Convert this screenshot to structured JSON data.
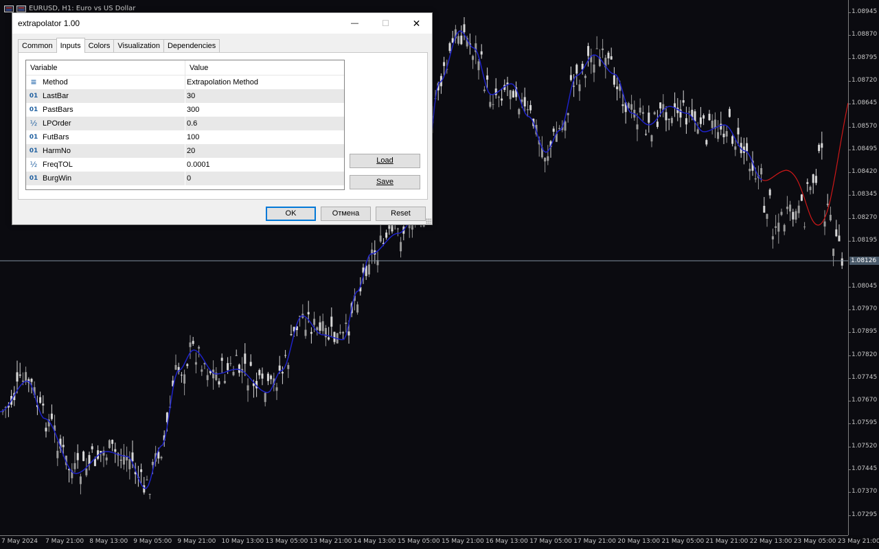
{
  "chart": {
    "title": "EURUSD, H1:  Euro vs US Dollar",
    "current_price": "1.08126",
    "price_labels": [
      "1.08945",
      "1.08870",
      "1.08795",
      "1.08720",
      "1.08645",
      "1.08570",
      "1.08495",
      "1.08420",
      "1.08345",
      "1.08270",
      "1.08195",
      "1.08045",
      "1.07970",
      "1.07895",
      "1.07820",
      "1.07745",
      "1.07670",
      "1.07595",
      "1.07520",
      "1.07445",
      "1.07370",
      "1.07295"
    ],
    "time_labels": [
      "7 May 2024",
      "7 May 21:00",
      "8 May 13:00",
      "9 May 05:00",
      "9 May 21:00",
      "10 May 13:00",
      "13 May 05:00",
      "13 May 21:00",
      "14 May 13:00",
      "15 May 05:00",
      "15 May 21:00",
      "16 May 13:00",
      "17 May 05:00",
      "17 May 21:00",
      "20 May 13:00",
      "21 May 05:00",
      "21 May 21:00",
      "22 May 13:00",
      "23 May 05:00",
      "23 May 21:00"
    ],
    "colors": {
      "background": "#0b0b10",
      "candles": "#c0c0c0",
      "fit_line": "#1e22c8",
      "forecast_line": "#d01818",
      "price_line": "#8090a0"
    }
  },
  "dialog": {
    "title": "extrapolator 1.00",
    "minimize_icon": "—",
    "maximize_icon": "☐",
    "close_icon": "✕",
    "tabs": [
      {
        "label": "Common"
      },
      {
        "label": "Inputs"
      },
      {
        "label": "Colors"
      },
      {
        "label": "Visualization"
      },
      {
        "label": "Dependencies"
      }
    ],
    "active_tab": "Inputs",
    "grid": {
      "header_variable": "Variable",
      "header_value": "Value",
      "rows": [
        {
          "icon": "≡",
          "variable": "Method",
          "value": "Extrapolation Method"
        },
        {
          "icon": "01",
          "variable": "LastBar",
          "value": "30"
        },
        {
          "icon": "01",
          "variable": "PastBars",
          "value": "300"
        },
        {
          "icon": "½",
          "variable": "LPOrder",
          "value": "0.6"
        },
        {
          "icon": "01",
          "variable": "FutBars",
          "value": "100"
        },
        {
          "icon": "01",
          "variable": "HarmNo",
          "value": "20"
        },
        {
          "icon": "½",
          "variable": "FreqTOL",
          "value": "0.0001"
        },
        {
          "icon": "01",
          "variable": "BurgWin",
          "value": "0"
        }
      ]
    },
    "load_label": "Load",
    "save_label": "Save",
    "ok_label": "OK",
    "cancel_label": "Отмена",
    "reset_label": "Reset"
  }
}
